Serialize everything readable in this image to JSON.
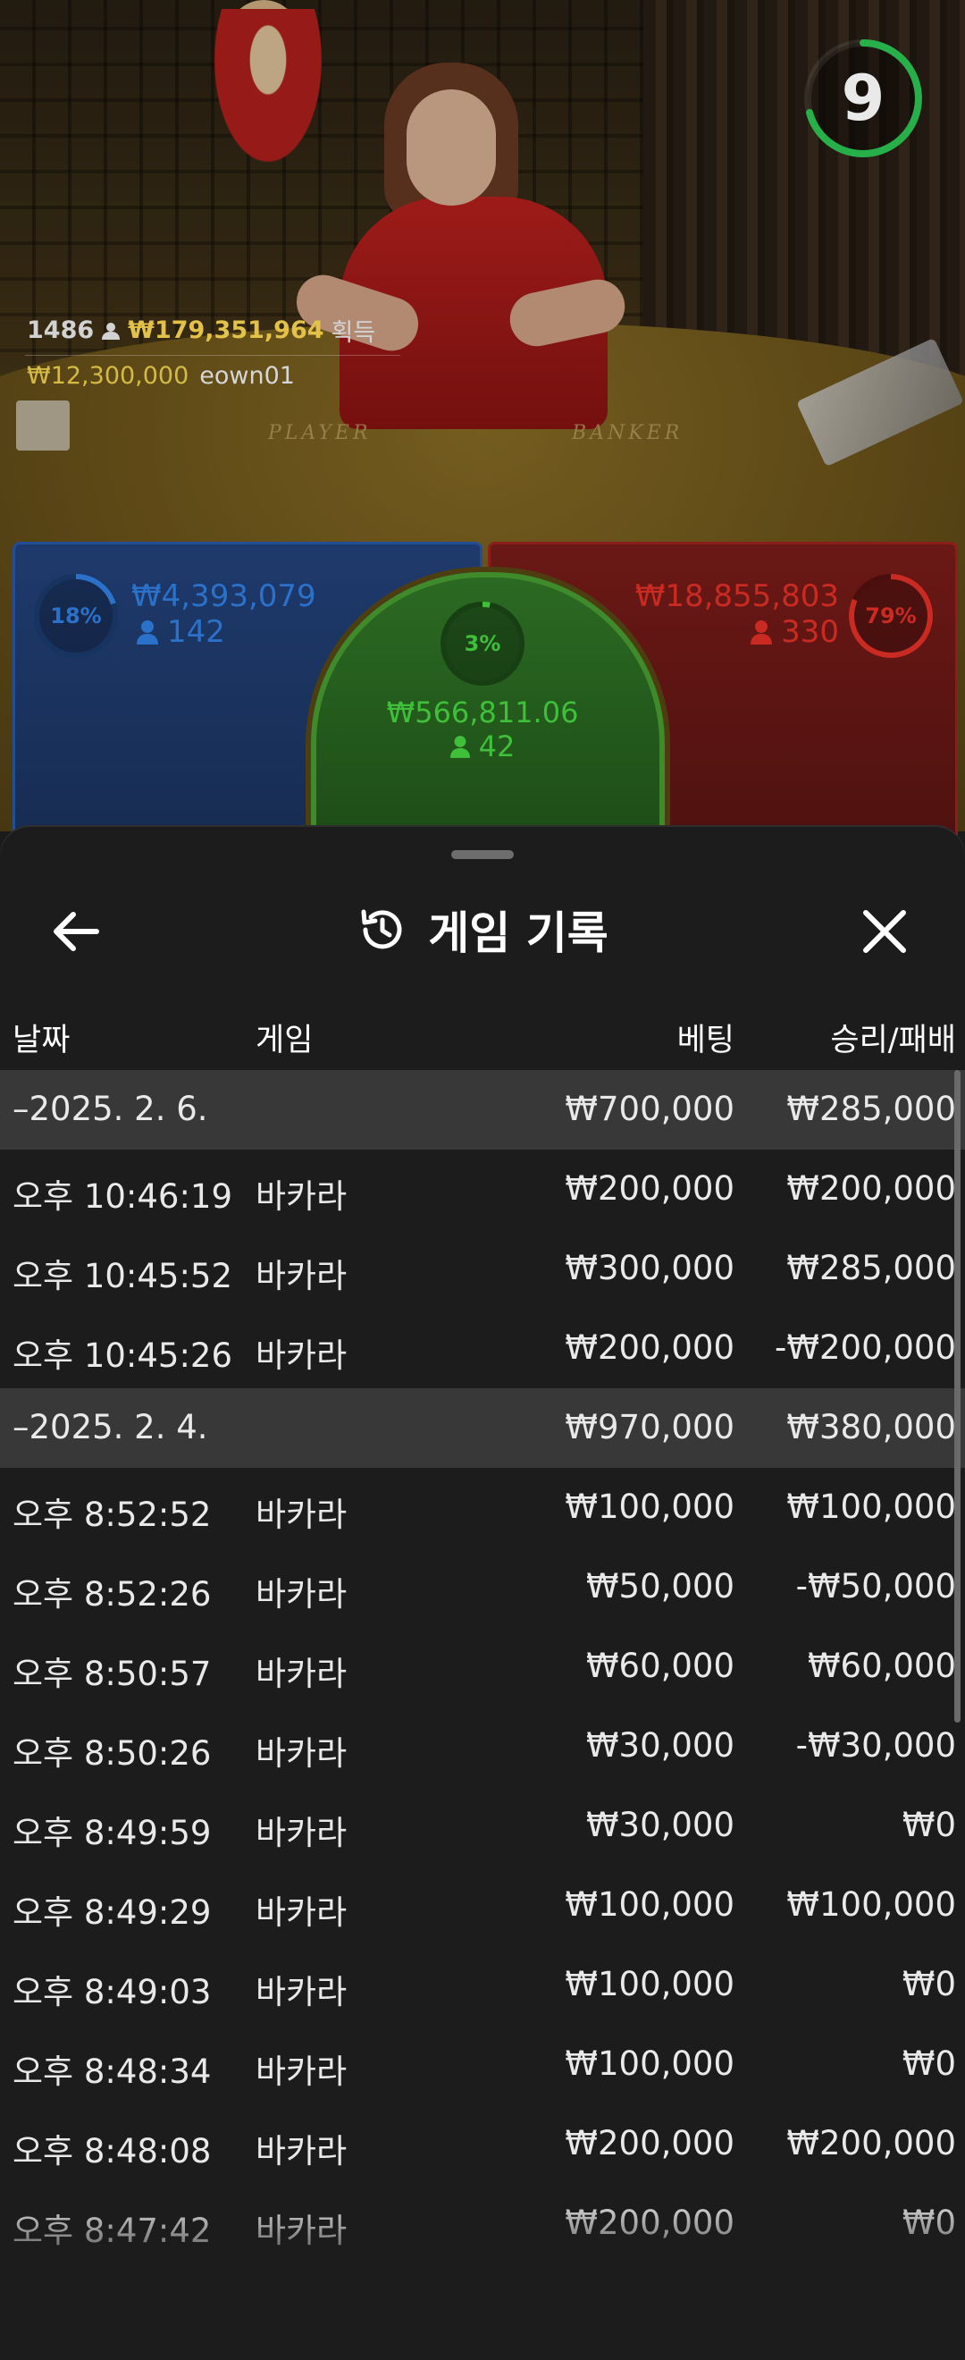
{
  "live": {
    "timer": "9",
    "players_online": "1486",
    "total_won": "₩179,351,964",
    "won_label": "획득",
    "last_win_amount": "₩12,300,000",
    "last_win_user": "eown01",
    "felt_player": "PLAYER",
    "felt_banker": "BANKER",
    "colors": {
      "player": "#2b71c9",
      "banker": "#c92a22",
      "tie": "#3fbf3a",
      "timer": "#27b04a",
      "gold": "#e3c24a"
    }
  },
  "bets": {
    "player": {
      "percent": "18%",
      "percent_value": 0.18,
      "amount": "₩4,393,079",
      "count": "142"
    },
    "tie": {
      "percent": "3%",
      "percent_value": 0.03,
      "amount": "₩566,811.06",
      "count": "42"
    },
    "banker": {
      "percent": "79%",
      "percent_value": 0.79,
      "amount": "₩18,855,803",
      "count": "330"
    }
  },
  "history": {
    "title": "게임 기록",
    "icons": {
      "back": "arrow-left-icon",
      "title": "history-icon",
      "close": "close-icon"
    },
    "columns": {
      "date": "날짜",
      "game": "게임",
      "bet": "베팅",
      "result": "승리/패배"
    },
    "rows": [
      {
        "type": "group",
        "date": "–2025. 2. 6.",
        "game": "",
        "bet": "₩700,000",
        "result": "₩285,000"
      },
      {
        "type": "item",
        "date": "오후 10:46:19",
        "game": "바카라",
        "bet": "₩200,000",
        "result": "₩200,000"
      },
      {
        "type": "item",
        "date": "오후 10:45:52",
        "game": "바카라",
        "bet": "₩300,000",
        "result": "₩285,000"
      },
      {
        "type": "item",
        "date": "오후 10:45:26",
        "game": "바카라",
        "bet": "₩200,000",
        "result": "-₩200,000"
      },
      {
        "type": "group",
        "date": "–2025. 2. 4.",
        "game": "",
        "bet": "₩970,000",
        "result": "₩380,000"
      },
      {
        "type": "item",
        "date": "오후 8:52:52",
        "game": "바카라",
        "bet": "₩100,000",
        "result": "₩100,000"
      },
      {
        "type": "item",
        "date": "오후 8:52:26",
        "game": "바카라",
        "bet": "₩50,000",
        "result": "-₩50,000"
      },
      {
        "type": "item",
        "date": "오후 8:50:57",
        "game": "바카라",
        "bet": "₩60,000",
        "result": "₩60,000"
      },
      {
        "type": "item",
        "date": "오후 8:50:26",
        "game": "바카라",
        "bet": "₩30,000",
        "result": "-₩30,000"
      },
      {
        "type": "item",
        "date": "오후 8:49:59",
        "game": "바카라",
        "bet": "₩30,000",
        "result": "₩0"
      },
      {
        "type": "item",
        "date": "오후 8:49:29",
        "game": "바카라",
        "bet": "₩100,000",
        "result": "₩100,000"
      },
      {
        "type": "item",
        "date": "오후 8:49:03",
        "game": "바카라",
        "bet": "₩100,000",
        "result": "₩0"
      },
      {
        "type": "item",
        "date": "오후 8:48:34",
        "game": "바카라",
        "bet": "₩100,000",
        "result": "₩0"
      },
      {
        "type": "item",
        "date": "오후 8:48:08",
        "game": "바카라",
        "bet": "₩200,000",
        "result": "₩200,000"
      },
      {
        "type": "item",
        "date": "오후 8:47:42",
        "game": "바카라",
        "bet": "₩200,000",
        "result": "₩0"
      }
    ]
  }
}
